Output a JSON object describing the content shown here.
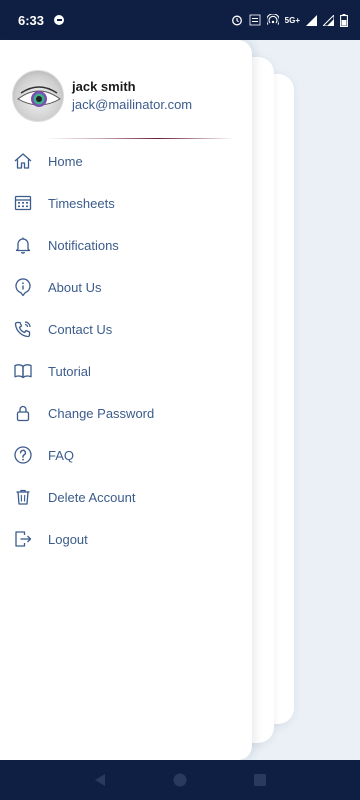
{
  "status_bar": {
    "time": "6:33",
    "network": "5G+"
  },
  "profile": {
    "name": "jack smith",
    "email": "jack@mailinator.com"
  },
  "menu": [
    {
      "label": "Home",
      "icon": "home-icon"
    },
    {
      "label": "Timesheets",
      "icon": "calendar-icon"
    },
    {
      "label": "Notifications",
      "icon": "bell-icon"
    },
    {
      "label": "About Us",
      "icon": "info-icon"
    },
    {
      "label": "Contact Us",
      "icon": "phone-icon"
    },
    {
      "label": "Tutorial",
      "icon": "book-icon"
    },
    {
      "label": "Change Password",
      "icon": "lock-icon"
    },
    {
      "label": "FAQ",
      "icon": "question-icon"
    },
    {
      "label": "Delete Account",
      "icon": "trash-icon"
    },
    {
      "label": "Logout",
      "icon": "logout-icon"
    }
  ],
  "colors": {
    "primary": "#3b5c8c",
    "navbar": "#0f1f44"
  }
}
